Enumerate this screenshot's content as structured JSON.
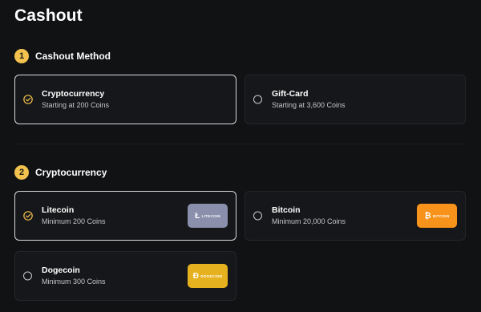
{
  "page": {
    "title": "Cashout"
  },
  "steps": [
    {
      "number": "1",
      "title": "Cashout Method"
    },
    {
      "number": "2",
      "title": "Cryptocurrency"
    }
  ],
  "methods": [
    {
      "name": "Cryptocurrency",
      "detail": "Starting at 200 Coins",
      "selected": true
    },
    {
      "name": "Gift-Card",
      "detail": "Starting at 3,600 Coins",
      "selected": false
    }
  ],
  "coins": [
    {
      "name": "Litecoin",
      "detail": "Minimum 200 Coins",
      "selected": true,
      "badge_text": "LITECOIN",
      "badge_glyph": "Ł",
      "badge_color": "#8a8fab",
      "icon": "litecoin-icon"
    },
    {
      "name": "Bitcoin",
      "detail": "Minimum 20,000 Coins",
      "selected": false,
      "badge_text": "BITCOIN",
      "badge_glyph": "₿",
      "badge_color": "#f7931a",
      "icon": "bitcoin-icon"
    },
    {
      "name": "Dogecoin",
      "detail": "Minimum 300 Coins",
      "selected": false,
      "badge_text": "DOGECOIN",
      "badge_glyph": "Ð",
      "badge_color": "#e6b11e",
      "icon": "dogecoin-icon"
    }
  ],
  "colors": {
    "accent": "#f2c14e",
    "background": "#111214",
    "card": "#16171a"
  }
}
